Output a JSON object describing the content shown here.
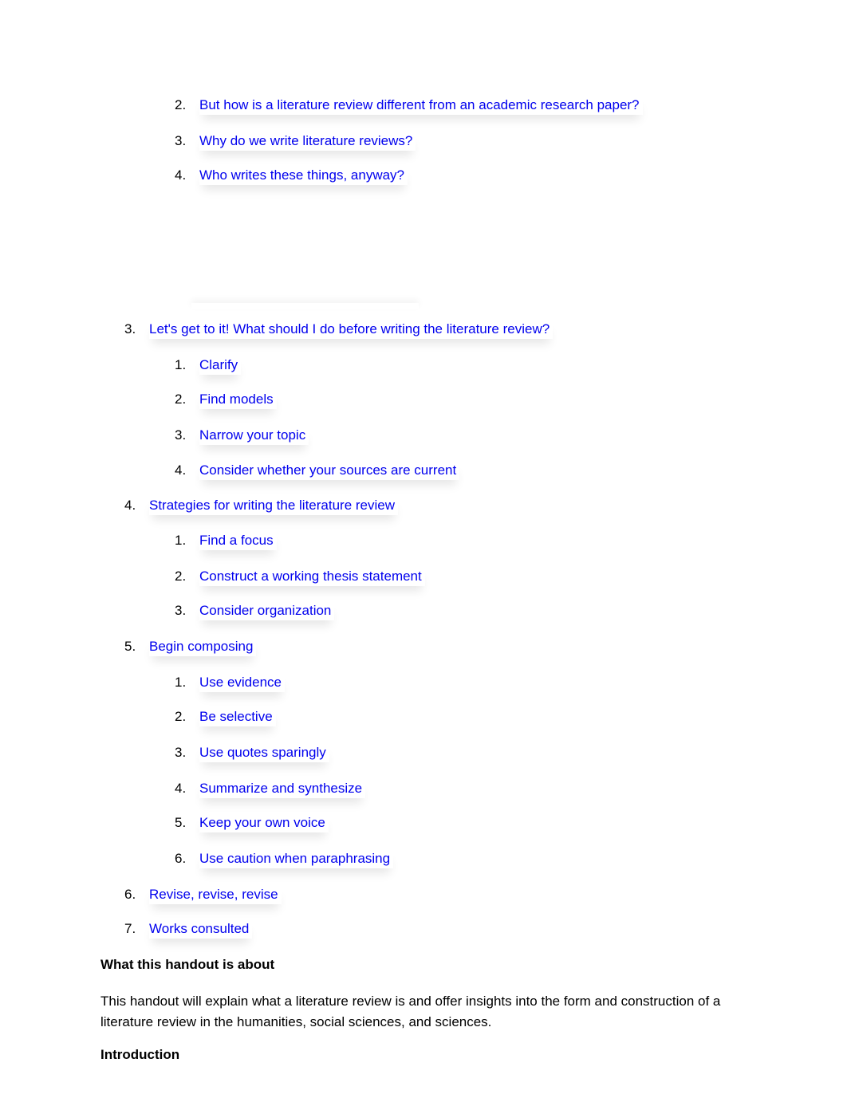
{
  "toc": [
    {
      "level": 2,
      "num": "2.",
      "text": "But how is a literature review different from an academic research paper?"
    },
    {
      "level": 2,
      "num": "3.",
      "text": "Why do we write literature reviews?"
    },
    {
      "level": 2,
      "num": "4.",
      "text": "Who writes these things, anyway?"
    },
    {
      "level": 1,
      "num": "3.",
      "text": "Let's get to it! What should I do before writing the literature review?"
    },
    {
      "level": 2,
      "num": "1.",
      "text": "Clarify"
    },
    {
      "level": 2,
      "num": "2.",
      "text": "Find models"
    },
    {
      "level": 2,
      "num": "3.",
      "text": "Narrow your topic"
    },
    {
      "level": 2,
      "num": "4.",
      "text": "Consider whether your sources are current"
    },
    {
      "level": 1,
      "num": "4.",
      "text": "Strategies for writing the literature review"
    },
    {
      "level": 2,
      "num": "1.",
      "text": "Find a focus"
    },
    {
      "level": 2,
      "num": "2.",
      "text": "Construct a working thesis statement"
    },
    {
      "level": 2,
      "num": "3.",
      "text": "Consider organization"
    },
    {
      "level": 1,
      "num": "5.",
      "text": "Begin composing"
    },
    {
      "level": 2,
      "num": "1.",
      "text": "Use evidence"
    },
    {
      "level": 2,
      "num": "2.",
      "text": "Be selective"
    },
    {
      "level": 2,
      "num": "3.",
      "text": "Use quotes sparingly"
    },
    {
      "level": 2,
      "num": "4.",
      "text": "Summarize and synthesize"
    },
    {
      "level": 2,
      "num": "5.",
      "text": "Keep your own voice"
    },
    {
      "level": 2,
      "num": "6.",
      "text": "Use caution when paraphrasing"
    },
    {
      "level": 1,
      "num": "6.",
      "text": "Revise, revise, revise"
    },
    {
      "level": 1,
      "num": "7.",
      "text": "Works consulted"
    }
  ],
  "section1": {
    "heading": "What this handout is about",
    "body": "This handout will explain what a literature review is and offer insights into the form and construction of a literature review in the humanities, social sciences, and sciences."
  },
  "section2": {
    "heading": "Introduction"
  },
  "colors": {
    "link": "#0000ee",
    "text": "#000000"
  }
}
